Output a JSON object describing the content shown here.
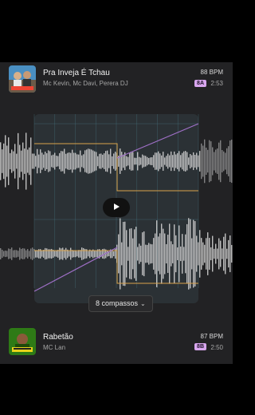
{
  "track_a": {
    "title": "Pra Inveja É Tchau",
    "artists": "Mc Kevin, Mc Davi, Perera DJ",
    "bpm": "88 BPM",
    "key": "8A",
    "duration": "2:53",
    "key_color": "#d8a6ee"
  },
  "track_b": {
    "title": "Rabetão",
    "artists": "MC Lan",
    "bpm": "87 BPM",
    "key": "8B",
    "duration": "2:50",
    "key_color": "#d8a6ee"
  },
  "transition": {
    "length_label": "8 compassos"
  },
  "colors": {
    "crossfade_line": "#a070c8",
    "eq_line": "#d9a24a",
    "grid_line": "#4a7c8a",
    "waveform": "#d0d0d0"
  }
}
